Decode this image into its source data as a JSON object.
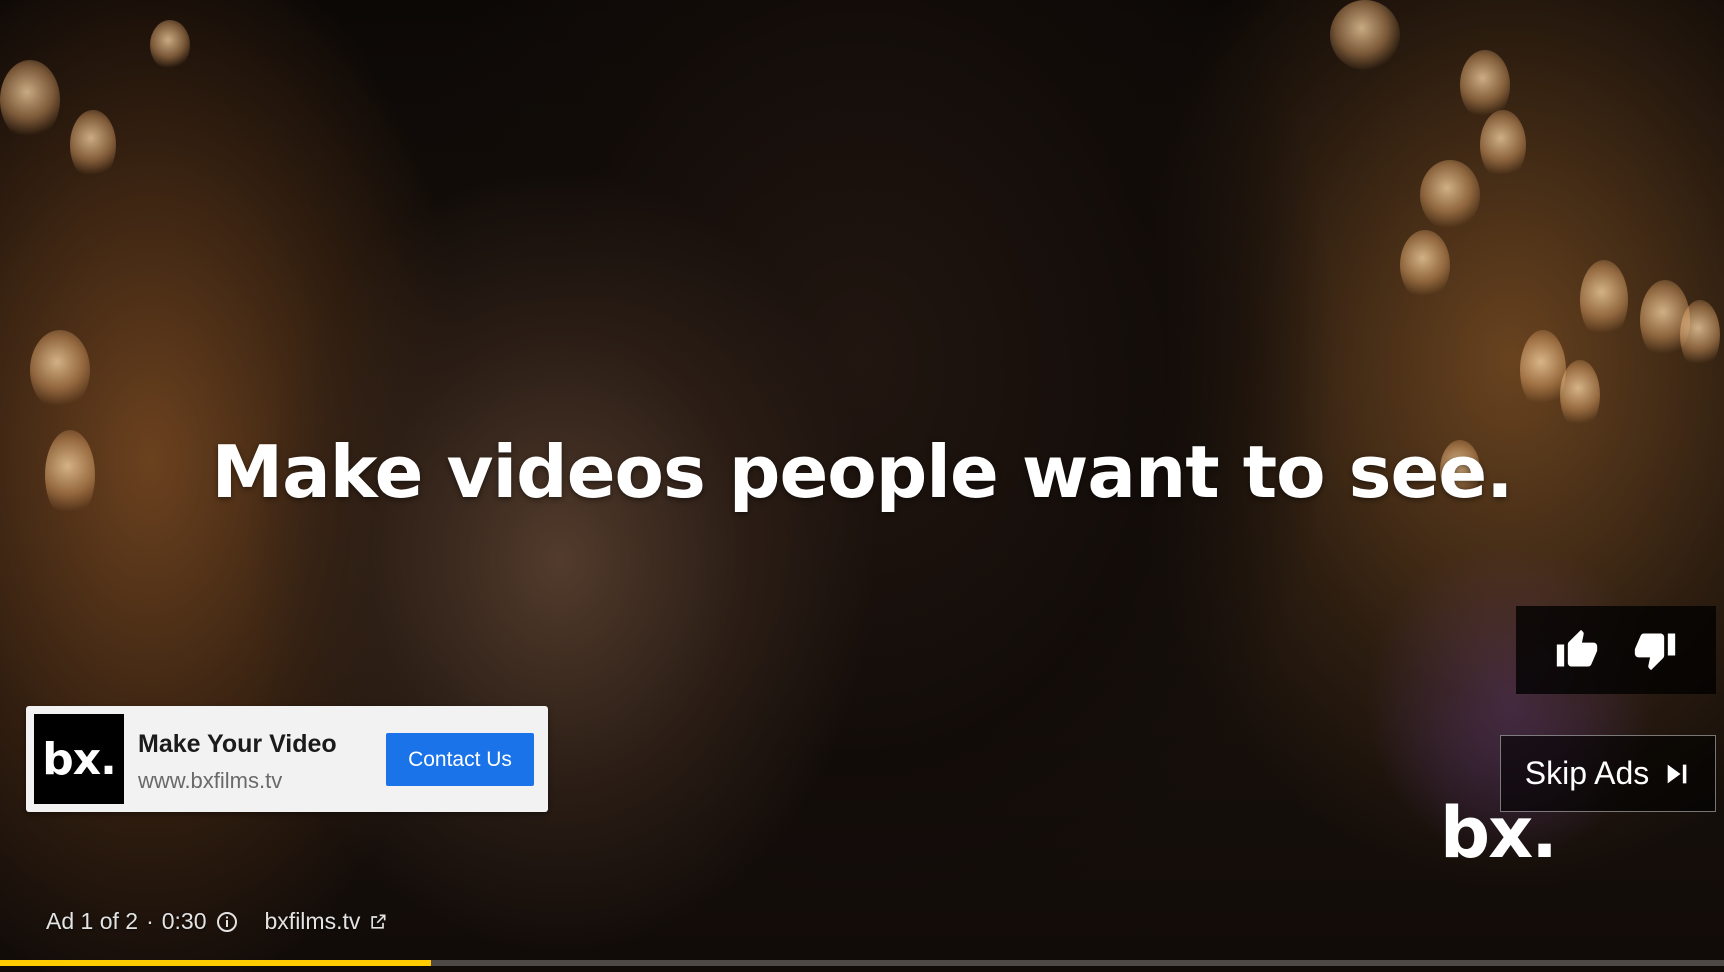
{
  "ad": {
    "headline": "Make videos people want to see.",
    "card": {
      "logo_text": "bx.",
      "title": "Make Your Video",
      "url": "www.bxfilms.tv",
      "cta_label": "Contact Us"
    },
    "watermark": "bx.",
    "skip_label": "Skip Ads",
    "info": {
      "counter": "Ad 1 of 2",
      "separator": "·",
      "duration": "0:30",
      "domain": "bxfilms.tv"
    },
    "progress_fraction": 0.25,
    "colors": {
      "accent": "#ffcc00",
      "cta": "#1a73e8"
    },
    "icons": {
      "like": "thumbs-up-icon",
      "dislike": "thumbs-down-icon",
      "skip": "skip-next-icon",
      "info": "info-icon",
      "external": "external-link-icon"
    }
  }
}
